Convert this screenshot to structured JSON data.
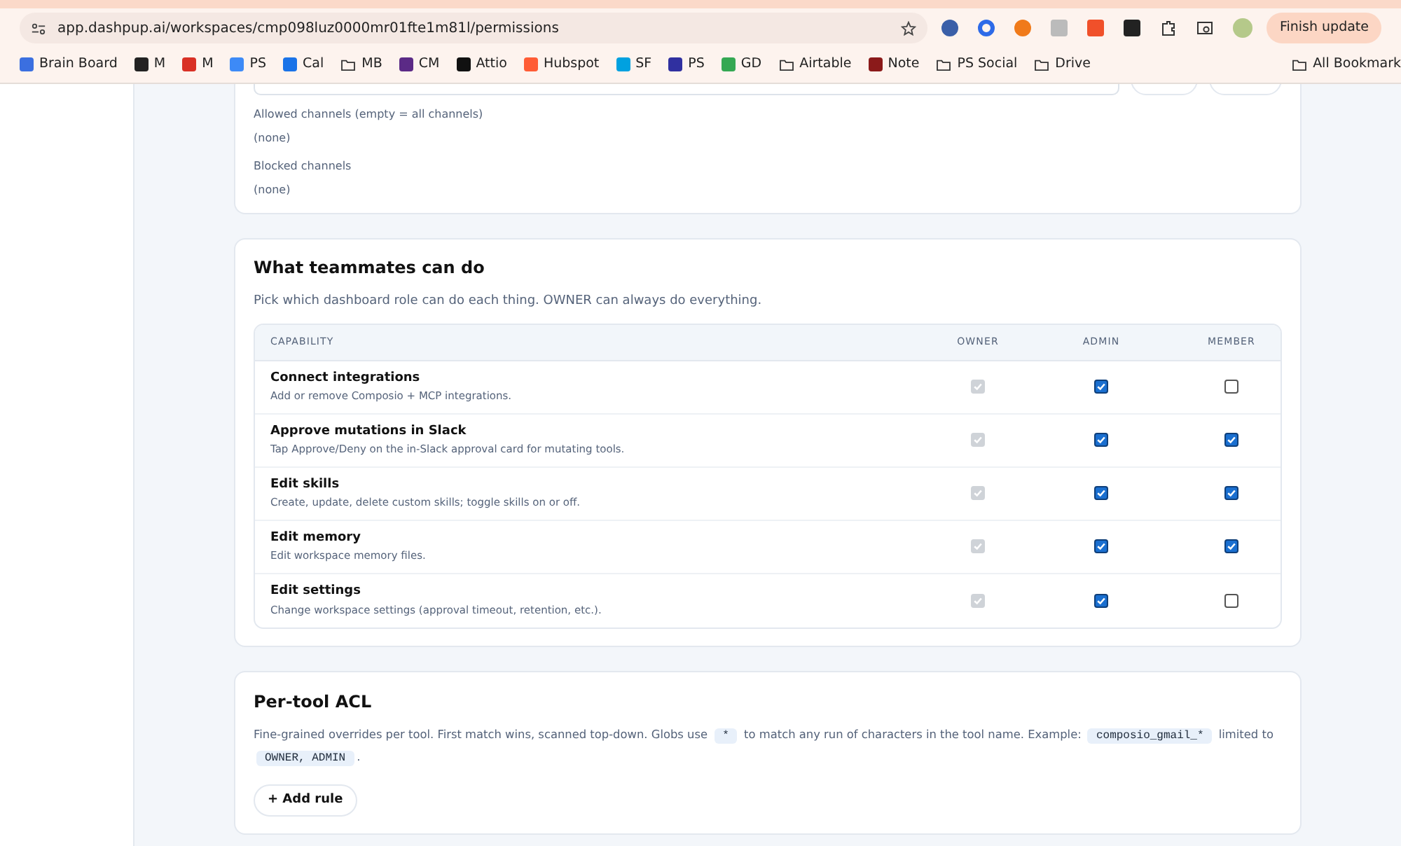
{
  "browser": {
    "url": "app.dashpup.ai/workspaces/cmp098luz0000mr01fte1m81l/permissions",
    "update_button": "Finish update",
    "bookmarks": [
      {
        "label": "Brain Board",
        "kind": "site",
        "color": "#3b6fe0"
      },
      {
        "label": "M",
        "kind": "site",
        "color": "#222222"
      },
      {
        "label": "M",
        "kind": "site",
        "color": "#d93025"
      },
      {
        "label": "PS",
        "kind": "site",
        "color": "#3d8af7"
      },
      {
        "label": "Cal",
        "kind": "site",
        "color": "#1a73e8"
      },
      {
        "label": "MB",
        "kind": "folder"
      },
      {
        "label": "CM",
        "kind": "site",
        "color": "#5b2a86"
      },
      {
        "label": "Attio",
        "kind": "site",
        "color": "#111111"
      },
      {
        "label": "Hubspot",
        "kind": "site",
        "color": "#ff5c35"
      },
      {
        "label": "SF",
        "kind": "site",
        "color": "#00a1e0"
      },
      {
        "label": "PS",
        "kind": "site",
        "color": "#3030a0"
      },
      {
        "label": "GD",
        "kind": "site",
        "color": "#34a853"
      },
      {
        "label": "Airtable",
        "kind": "folder"
      },
      {
        "label": "Note",
        "kind": "site",
        "color": "#8b1a1a"
      },
      {
        "label": "PS Social",
        "kind": "folder"
      },
      {
        "label": "Drive",
        "kind": "folder"
      }
    ],
    "all_bookmarks": "All Bookmark"
  },
  "channels_card": {
    "lists": [
      {
        "label": "Allowed channels (empty = all channels)",
        "value": "(none)"
      },
      {
        "label": "Blocked channels",
        "value": "(none)"
      }
    ]
  },
  "teammates": {
    "title": "What teammates can do",
    "description": "Pick which dashboard role can do each thing. OWNER can always do everything.",
    "columns": [
      "CAPABILITY",
      "OWNER",
      "ADMIN",
      "MEMBER"
    ],
    "rows": [
      {
        "name": "Connect integrations",
        "description": "Add or remove Composio + MCP integrations.",
        "owner": true,
        "admin": true,
        "member": false
      },
      {
        "name": "Approve mutations in Slack",
        "description": "Tap Approve/Deny on the in-Slack approval card for mutating tools.",
        "owner": true,
        "admin": true,
        "member": true
      },
      {
        "name": "Edit skills",
        "description": "Create, update, delete custom skills; toggle skills on or off.",
        "owner": true,
        "admin": true,
        "member": true
      },
      {
        "name": "Edit memory",
        "description": "Edit workspace memory files.",
        "owner": true,
        "admin": true,
        "member": true
      },
      {
        "name": "Edit settings",
        "description": "Change workspace settings (approval timeout, retention, etc.).",
        "owner": true,
        "admin": true,
        "member": false
      }
    ]
  },
  "acl": {
    "title": "Per-tool ACL",
    "description": [
      {
        "kind": "text",
        "text": "Fine-grained overrides per tool. First match wins, scanned top-down. Globs use "
      },
      {
        "kind": "code",
        "text": "*"
      },
      {
        "kind": "text",
        "text": " to match any run of characters in the tool name. Example: "
      },
      {
        "kind": "code",
        "text": "composio_gmail_*"
      },
      {
        "kind": "text",
        "text": " limited to "
      },
      {
        "kind": "code",
        "text": "OWNER, ADMIN"
      },
      {
        "kind": "text",
        "text": "."
      }
    ],
    "add_button": "+ Add rule"
  }
}
